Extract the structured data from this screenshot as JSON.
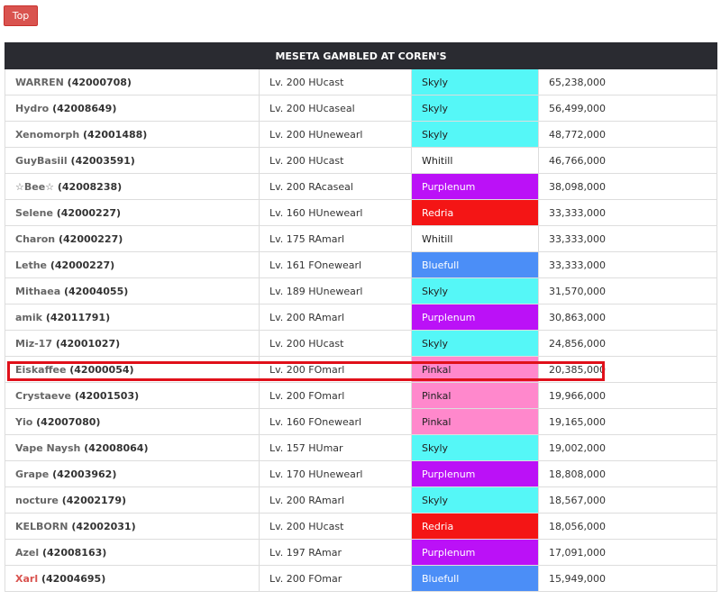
{
  "top_button": {
    "label": "Top"
  },
  "table": {
    "title": "MESETA GAMBLED AT COREN'S",
    "rows": [
      {
        "name": "WARREN",
        "id": "(42000708)",
        "level": "Lv. 200 HUcast",
        "section_id": "Skyly",
        "section_color": "#55f7f7",
        "amount": "65,238,000"
      },
      {
        "name": "Hydro",
        "id": "(42008649)",
        "level": "Lv. 200 HUcaseal",
        "section_id": "Skyly",
        "section_color": "#55f7f7",
        "amount": "56,499,000"
      },
      {
        "name": "Xenomorph",
        "id": "(42001488)",
        "level": "Lv. 200 HUnewearl",
        "section_id": "Skyly",
        "section_color": "#55f7f7",
        "amount": "48,772,000"
      },
      {
        "name": "GuyBasiil",
        "id": "(42003591)",
        "level": "Lv. 200 HUcast",
        "section_id": "Whitill",
        "section_color": "#ffffff",
        "amount": "46,766,000"
      },
      {
        "name": "☆Bee☆",
        "id": "(42008238)",
        "level": "Lv. 200 RAcaseal",
        "section_id": "Purplenum",
        "section_color": "#bb11f7",
        "amount": "38,098,000"
      },
      {
        "name": "Selene",
        "id": "(42000227)",
        "level": "Lv. 160 HUnewearl",
        "section_id": "Redria",
        "section_color": "#f41515",
        "amount": "33,333,000"
      },
      {
        "name": "Charon",
        "id": "(42000227)",
        "level": "Lv. 175 RAmarl",
        "section_id": "Whitill",
        "section_color": "#ffffff",
        "amount": "33,333,000"
      },
      {
        "name": "Lethe",
        "id": "(42000227)",
        "level": "Lv. 161 FOnewearl",
        "section_id": "Bluefull",
        "section_color": "#4b8ef7",
        "amount": "33,333,000"
      },
      {
        "name": "Mithaea",
        "id": "(42004055)",
        "level": "Lv. 189 HUnewearl",
        "section_id": "Skyly",
        "section_color": "#55f7f7",
        "amount": "31,570,000"
      },
      {
        "name": "amik",
        "id": "(42011791)",
        "level": "Lv. 200 RAmarl",
        "section_id": "Purplenum",
        "section_color": "#bb11f7",
        "amount": "30,863,000"
      },
      {
        "name": "Miz-17",
        "id": "(42001027)",
        "level": "Lv. 200 HUcast",
        "section_id": "Skyly",
        "section_color": "#55f7f7",
        "amount": "24,856,000"
      },
      {
        "name": "Eiskaffee",
        "id": "(42000054)",
        "level": "Lv. 200 FOmarl",
        "section_id": "Pinkal",
        "section_color": "#ff88cc",
        "amount": "20,385,000"
      },
      {
        "name": "Crystaeve",
        "id": "(42001503)",
        "level": "Lv. 200 FOmarl",
        "section_id": "Pinkal",
        "section_color": "#ff88cc",
        "amount": "19,966,000"
      },
      {
        "name": "Yio",
        "id": "(42007080)",
        "level": "Lv. 160 FOnewearl",
        "section_id": "Pinkal",
        "section_color": "#ff88cc",
        "amount": "19,165,000"
      },
      {
        "name": "Vape Naysh",
        "id": "(42008064)",
        "level": "Lv. 157 HUmar",
        "section_id": "Skyly",
        "section_color": "#55f7f7",
        "amount": "19,002,000"
      },
      {
        "name": "Grape",
        "id": "(42003962)",
        "level": "Lv. 170 HUnewearl",
        "section_id": "Purplenum",
        "section_color": "#bb11f7",
        "amount": "18,808,000"
      },
      {
        "name": "nocture",
        "id": "(42002179)",
        "level": "Lv. 200 RAmarl",
        "section_id": "Skyly",
        "section_color": "#55f7f7",
        "amount": "18,567,000"
      },
      {
        "name": "KELBORN",
        "id": "(42002031)",
        "level": "Lv. 200 HUcast",
        "section_id": "Redria",
        "section_color": "#f41515",
        "amount": "18,056,000"
      },
      {
        "name": "Azel",
        "id": "(42008163)",
        "level": "Lv. 197 RAmar",
        "section_id": "Purplenum",
        "section_color": "#bb11f7",
        "amount": "17,091,000"
      },
      {
        "name": "Xarl",
        "id": "(42004695)",
        "level": "Lv. 200 FOmar",
        "section_id": "Bluefull",
        "section_color": "#4b8ef7",
        "amount": "15,949,000",
        "name_color": "#d9534f"
      }
    ]
  }
}
